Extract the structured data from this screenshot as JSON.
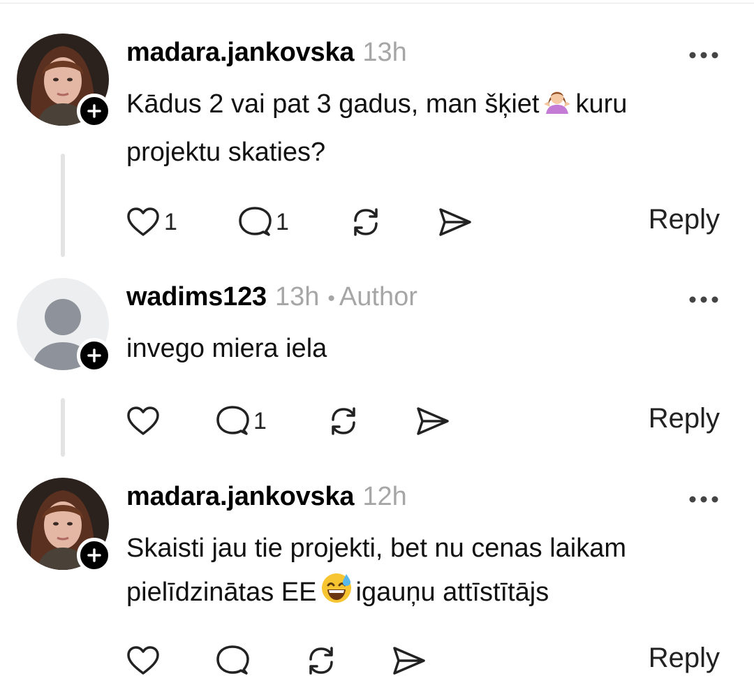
{
  "comments": [
    {
      "username": "madara.jankovska",
      "time": "13h",
      "author_badge": "",
      "text_before_emoji": "Kādus 2 vai pat 3 gadus, man šķiet",
      "emoji": "person-shrugging",
      "text_after_emoji": "kuru projektu skaties?",
      "likes": "1",
      "replies": "1",
      "reply_label": "Reply",
      "avatar": "profile-photo"
    },
    {
      "username": "wadims123",
      "time": "13h",
      "author_badge": "Author",
      "text_before_emoji": "invego miera iela",
      "emoji": "",
      "text_after_emoji": "",
      "likes": "",
      "replies": "1",
      "reply_label": "Reply",
      "avatar": "default-avatar"
    },
    {
      "username": "madara.jankovska",
      "time": "12h",
      "author_badge": "",
      "text_before_emoji": "Skaisti jau tie projekti, bet nu cenas laikam pielīdzinātas EE",
      "emoji": "grinning-face-with-sweat",
      "text_after_emoji": "igauņu attīstītājs",
      "likes": "",
      "replies": "",
      "reply_label": "Reply",
      "avatar": "profile-photo"
    }
  ],
  "meta_separator": "•",
  "icons": {
    "like": "heart-icon",
    "reply": "comment-icon",
    "repost": "repost-icon",
    "share": "send-icon",
    "more": "more-icon",
    "follow": "plus-icon"
  },
  "colors": {
    "text": "#000000",
    "muted": "#a6a6a6",
    "thread_line": "#e3e3e3",
    "badge": "#000000"
  }
}
